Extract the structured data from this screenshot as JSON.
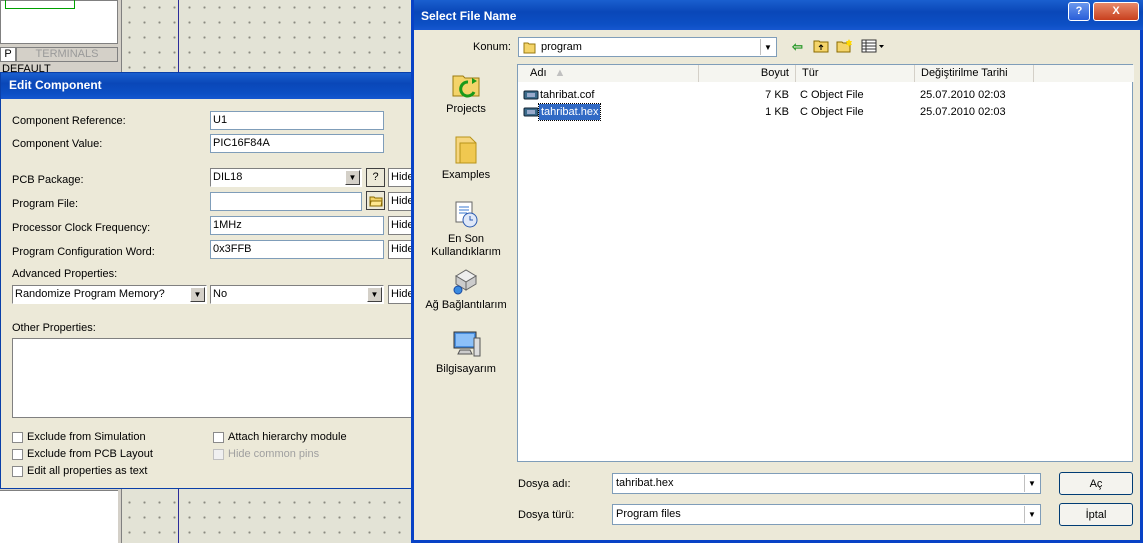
{
  "bg_panel": {
    "tab_p": "P",
    "tab_terminals": "TERMINALS",
    "default_label": "DEFAULT"
  },
  "edit": {
    "title": "Edit Component",
    "component_reference": {
      "label": "Component Reference:",
      "value": "U1"
    },
    "component_value": {
      "label": "Component Value:",
      "value": "PIC16F84A"
    },
    "pcb_package": {
      "label": "PCB Package:",
      "value": "DIL18",
      "help": "?",
      "hide": "Hide"
    },
    "program_file": {
      "label": "Program File:",
      "value": "",
      "hide": "Hide"
    },
    "clock": {
      "label": "Processor Clock Frequency:",
      "value": "1MHz",
      "hide": "Hide"
    },
    "config_word": {
      "label": "Program Configuration Word:",
      "value": "0x3FFB",
      "hide": "Hide"
    },
    "advanced_label": "Advanced Properties:",
    "advanced_property": "Randomize Program Memory?",
    "advanced_value": "No",
    "advanced_hide": "Hide",
    "other_properties_label": "Other Properties:",
    "checkboxes": {
      "exclude_simulation": "Exclude from Simulation",
      "exclude_pcb": "Exclude from PCB Layout",
      "edit_all": "Edit all properties as text",
      "attach_hierarchy": "Attach hierarchy module",
      "hide_common_pins": "Hide common pins"
    }
  },
  "file": {
    "title": "Select File Name",
    "help_btn": "?",
    "close_btn": "X",
    "location_label": "Konum:",
    "location_value": "program",
    "places": [
      "Projects",
      "Examples",
      "En Son Kullandıklarım",
      "Ağ Bağlantılarım",
      "Bilgisayarım"
    ],
    "columns": {
      "name": "Adı",
      "size": "Boyut",
      "type": "Tür",
      "modified": "Değiştirilme Tarihi"
    },
    "files": [
      {
        "name": "tahribat.cof",
        "size": "7 KB",
        "type": "C Object File",
        "modified": "25.07.2010 02:03"
      },
      {
        "name": "tahribat.hex",
        "size": "1 KB",
        "type": "C Object File",
        "modified": "25.07.2010 02:03"
      }
    ],
    "filename_label": "Dosya adı:",
    "filename_value": "tahribat.hex",
    "filetype_label": "Dosya türü:",
    "filetype_value": "Program files",
    "open_btn": "Aç",
    "cancel_btn": "İptal"
  }
}
